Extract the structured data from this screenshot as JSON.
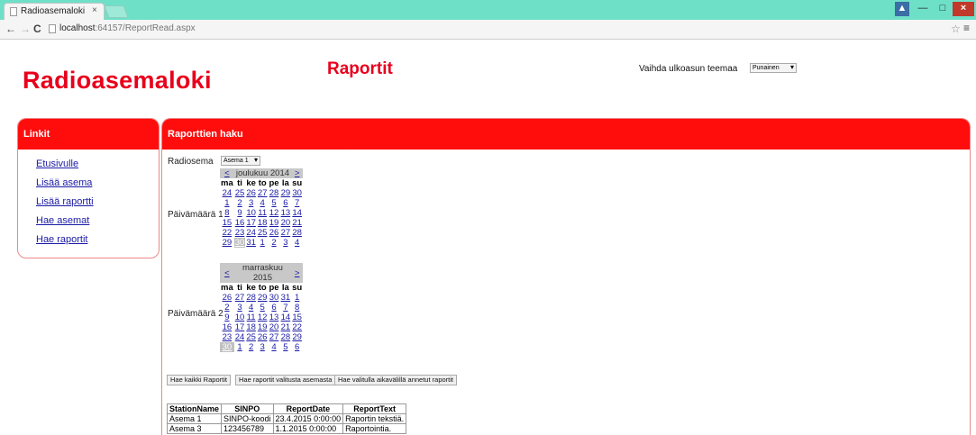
{
  "browser": {
    "tab_title": "Radioasemaloki",
    "tab_close": "×",
    "url_host": "localhost",
    "url_path": ":64157/ReportRead.aspx",
    "star": "☆",
    "menu": "≡"
  },
  "header": {
    "site_title": "Radioasemaloki",
    "page_title": "Raportit",
    "theme_label": "Vaihda ulkoasun teemaa",
    "theme_value": "Punainen"
  },
  "sidebar": {
    "heading": "Linkit",
    "links": [
      "Etusivulle",
      "Lisää asema",
      "Lisää raportti",
      "Hae asemat",
      "Hae raportit"
    ]
  },
  "main": {
    "heading": "Raporttien haku",
    "station_label": "Radiosema",
    "station_value": "Asema 1",
    "date1_label": "Päivämäärä 1",
    "date2_label": "Päivämäärä 2"
  },
  "calendar1": {
    "prev": "<",
    "next": ">",
    "title": "joulukuu 2014",
    "dow": [
      "ma",
      "ti",
      "ke",
      "to",
      "pe",
      "la",
      "su"
    ],
    "weeks": [
      [
        "24",
        "25",
        "26",
        "27",
        "28",
        "29",
        "30"
      ],
      [
        "1",
        "2",
        "3",
        "4",
        "5",
        "6",
        "7"
      ],
      [
        "8",
        "9",
        "10",
        "11",
        "12",
        "13",
        "14"
      ],
      [
        "15",
        "16",
        "17",
        "18",
        "19",
        "20",
        "21"
      ],
      [
        "22",
        "23",
        "24",
        "25",
        "26",
        "27",
        "28"
      ],
      [
        "29",
        "30",
        "31",
        "1",
        "2",
        "3",
        "4"
      ]
    ]
  },
  "calendar2": {
    "prev": "<",
    "next": ">",
    "title": "marraskuu 2015",
    "dow": [
      "ma",
      "ti",
      "ke",
      "to",
      "pe",
      "la",
      "su"
    ],
    "weeks": [
      [
        "26",
        "27",
        "28",
        "29",
        "30",
        "31",
        "1"
      ],
      [
        "2",
        "3",
        "4",
        "5",
        "6",
        "7",
        "8"
      ],
      [
        "9",
        "10",
        "11",
        "12",
        "13",
        "14",
        "15"
      ],
      [
        "16",
        "17",
        "18",
        "19",
        "20",
        "21",
        "22"
      ],
      [
        "23",
        "24",
        "25",
        "26",
        "27",
        "28",
        "29"
      ],
      [
        "30",
        "1",
        "2",
        "3",
        "4",
        "5",
        "6"
      ]
    ]
  },
  "buttons": {
    "all": "Hae kaikki Raportit",
    "by_station": "Hae raportit valitusta asemasta",
    "by_range": "Hae valitulla aikavälillä annetut raportit"
  },
  "results": {
    "columns": [
      "StationName",
      "SINPO",
      "ReportDate",
      "ReportText"
    ],
    "rows": [
      [
        "Asema 1",
        "SINPO-koodi",
        "23.4.2015 0:00:00",
        "Raportin tekstiä."
      ],
      [
        "Asema 3",
        "123456789",
        "1.1.2015 0:00:00",
        "Raportointia."
      ]
    ]
  }
}
